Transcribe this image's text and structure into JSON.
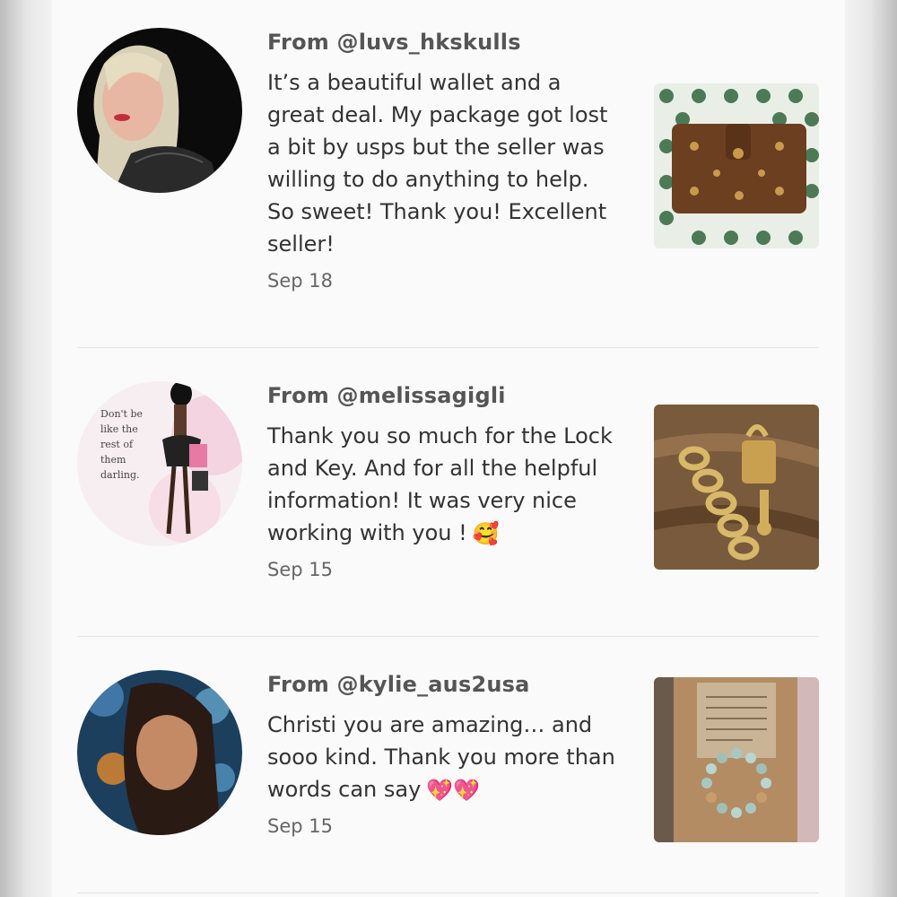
{
  "reviews": [
    {
      "username": "From @luvs_hkskulls",
      "text": "It’s a beautiful wallet and a great deal. My package got lost a bit by usps but the seller was willing to do anything to help. So sweet! Thank you! Excellent seller!",
      "date": "Sep 18",
      "avatar_icon": "user-avatar-blonde-woman",
      "photo_icon": "brown-monogram-wallet-photo"
    },
    {
      "username": "From @melissagigli",
      "text": "Thank you so much for the Lock and Key. And for all the helpful information! It was very nice working with you !",
      "emoji": "🥰",
      "date": "Sep 15",
      "avatar_icon": "fashion-illustration-avatar",
      "avatar_caption": "Don't be like the rest of them darling.",
      "photo_icon": "gold-chain-lock-key-photo"
    },
    {
      "username": "From @kylie_aus2usa",
      "text": "Christi you are amazing… and sooo kind. Thank you more than words can say",
      "emoji": "💖💖",
      "date": "Sep 15",
      "avatar_icon": "user-avatar-bokeh-woman",
      "photo_icon": "beaded-bracelet-card-photo"
    }
  ]
}
